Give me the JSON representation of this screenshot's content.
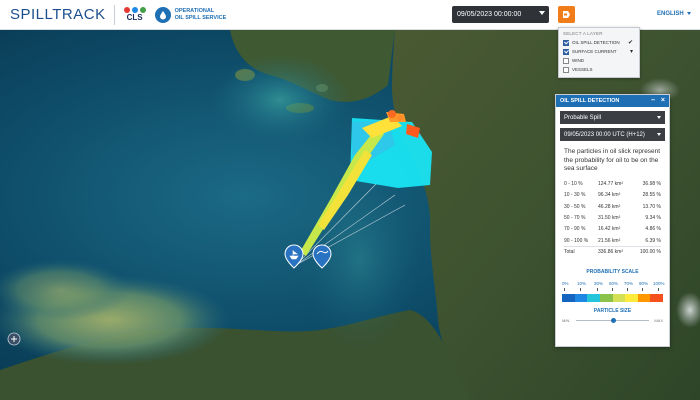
{
  "header": {
    "brand": "SPILLTRACK",
    "cls_logo_text": "CLS",
    "oss_line1": "OPERATIONAL",
    "oss_line2": "OIL SPILL SERVICE",
    "date_value": "09/05/2023 00:00:00",
    "language": "ENGLISH"
  },
  "tools": [
    "layers-icon",
    "edit-icon",
    "pen-icon",
    "download-icon",
    "share-icon",
    "fullscreen-icon"
  ],
  "layer_menu": {
    "title": "SELECT A LAYER",
    "items": [
      {
        "label": "OIL SPILL DETECTION",
        "checked": true
      },
      {
        "label": "SURFACE CURRENT",
        "checked": true
      },
      {
        "label": "WIND",
        "checked": false
      },
      {
        "label": "VESSELS",
        "checked": false
      }
    ]
  },
  "panel": {
    "title": "OIL SPILL DETECTION",
    "mode": "Probable Spill",
    "datetime": "09/05/2023  00:00  UTC   (H+12)",
    "description": "The particles in oil slick represent the probability for oil to be on the sea surface",
    "rows": [
      {
        "range": "0  -  10 %",
        "area": "124.77 km²",
        "pct": "36.98 %"
      },
      {
        "range": "10 - 30 %",
        "area": "96.34 km²",
        "pct": "28.55 %"
      },
      {
        "range": "30 - 50 %",
        "area": "46.28 km²",
        "pct": "13.70 %"
      },
      {
        "range": "50 - 70 %",
        "area": "31.50 km²",
        "pct": "9.34 %"
      },
      {
        "range": "70 - 90 %",
        "area": "16.42 km²",
        "pct": "4.86 %"
      },
      {
        "range": "90 - 100 %",
        "area": "21.56 km²",
        "pct": "6.39 %"
      }
    ],
    "total": {
      "label": "Total",
      "area": "336.86 km²",
      "pct": "100.00 %"
    },
    "probability_scale_label": "PROBABILITY SCALE",
    "scale_labels": [
      "0%",
      "10%",
      "30%",
      "50%",
      "70%",
      "90%",
      "100%"
    ],
    "scale_colors": [
      "#1565c0",
      "#1e88e5",
      "#26c6da",
      "#8bc34a",
      "#d4e157",
      "#ffeb3b",
      "#ff9800",
      "#f4511e"
    ],
    "particle_size_label": "PARTICLE SIZE",
    "size_min": "MIN",
    "size_max": "MAX",
    "particle_size_value": 0.5
  },
  "colors": {
    "brand_blue": "#1f6fb5",
    "accent_orange": "#f07d1a",
    "panel_header": "#1f6fb5"
  }
}
